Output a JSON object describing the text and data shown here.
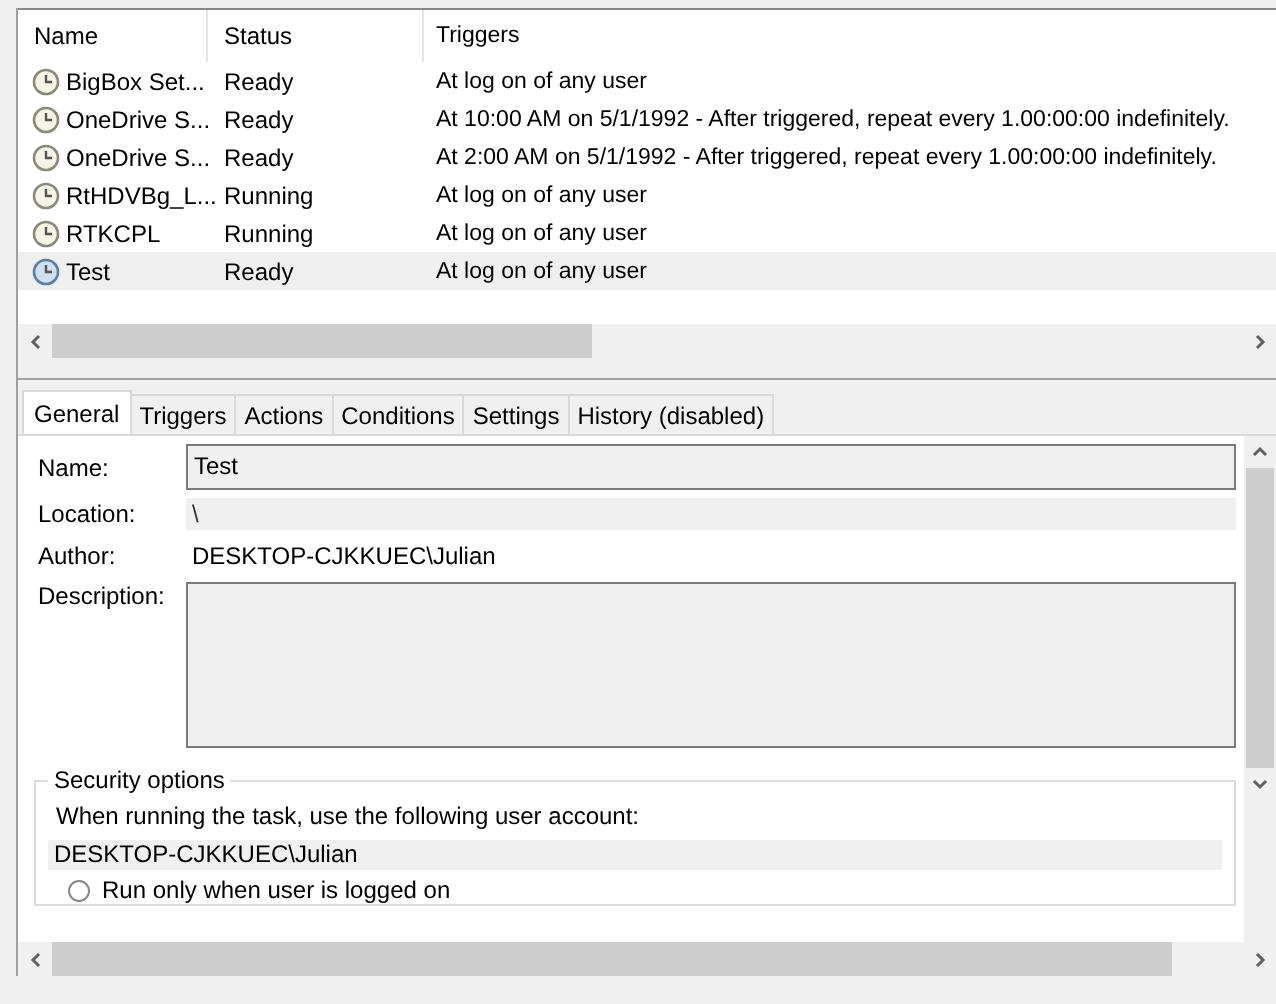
{
  "task_list": {
    "columns": [
      "Name",
      "Status",
      "Triggers"
    ],
    "rows": [
      {
        "name": "BigBox Set...",
        "status": "Ready",
        "trigger": "At log on of any user",
        "selected": false
      },
      {
        "name": "OneDrive S...",
        "status": "Ready",
        "trigger": "At 10:00 AM on 5/1/1992 - After triggered, repeat every 1.00:00:00 indefinitely.",
        "selected": false
      },
      {
        "name": "OneDrive S...",
        "status": "Ready",
        "trigger": "At 2:00 AM on 5/1/1992 - After triggered, repeat every 1.00:00:00 indefinitely.",
        "selected": false
      },
      {
        "name": "RtHDVBg_L...",
        "status": "Running",
        "trigger": "At log on of any user",
        "selected": false
      },
      {
        "name": "RTKCPL",
        "status": "Running",
        "trigger": "At log on of any user",
        "selected": false
      },
      {
        "name": "Test",
        "status": "Ready",
        "trigger": "At log on of any user",
        "selected": true
      }
    ]
  },
  "tabs": [
    {
      "label": "General",
      "selected": true
    },
    {
      "label": "Triggers",
      "selected": false
    },
    {
      "label": "Actions",
      "selected": false
    },
    {
      "label": "Conditions",
      "selected": false
    },
    {
      "label": "Settings",
      "selected": false
    },
    {
      "label": "History (disabled)",
      "selected": false
    }
  ],
  "general": {
    "name_label": "Name:",
    "name_value": "Test",
    "location_label": "Location:",
    "location_value": "\\",
    "author_label": "Author:",
    "author_value": "DESKTOP-CJKKUEC\\Julian",
    "description_label": "Description:",
    "security": {
      "title": "Security options",
      "account_prompt": "When running the task, use the following user account:",
      "account": "DESKTOP-CJKKUEC\\Julian",
      "radio_label": "Run only when user is logged on",
      "radio_selected": false
    }
  }
}
